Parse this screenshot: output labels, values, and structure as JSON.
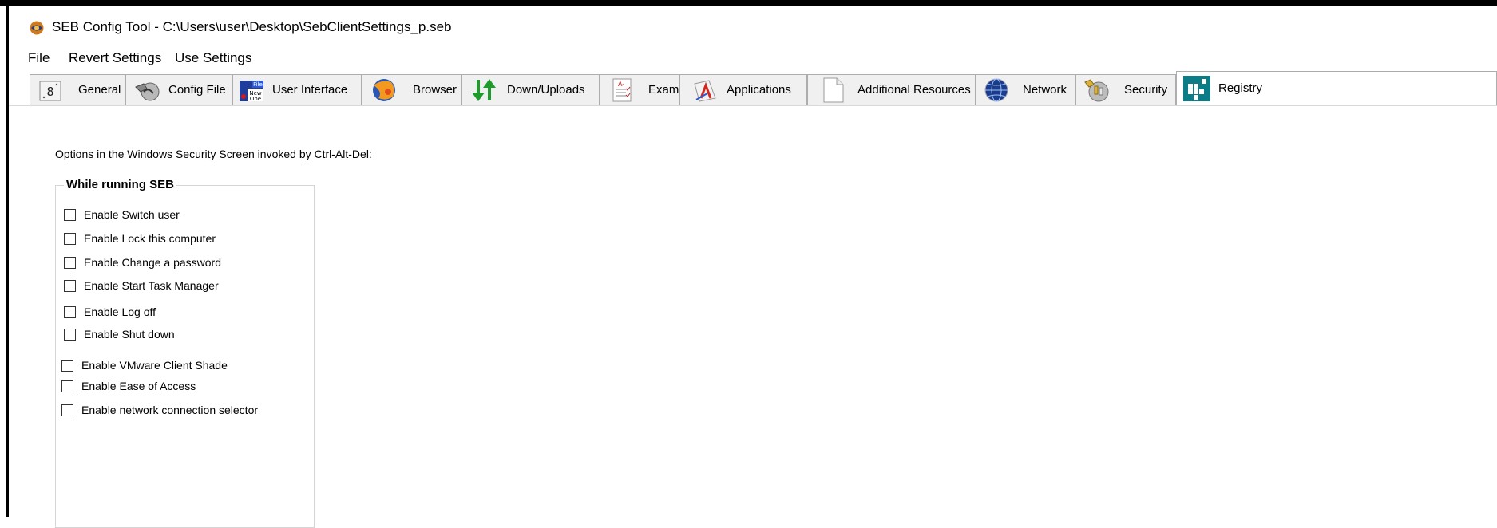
{
  "window": {
    "title": "SEB Config Tool - C:\\Users\\user\\Desktop\\SebClientSettings_p.seb",
    "icon": "seb-app-icon"
  },
  "menu": {
    "file": "File",
    "revert": "Revert Settings",
    "use": "Use Settings"
  },
  "tabs": [
    {
      "label": "General",
      "icon": "general-icon"
    },
    {
      "label": "Config File",
      "icon": "config-file-icon"
    },
    {
      "label": "User Interface",
      "icon": "user-interface-icon"
    },
    {
      "label": "Browser",
      "icon": "browser-icon"
    },
    {
      "label": "Down/Uploads",
      "icon": "down-uploads-icon"
    },
    {
      "label": "Exam",
      "icon": "exam-icon"
    },
    {
      "label": "Applications",
      "icon": "applications-icon"
    },
    {
      "label": "Additional Resources",
      "icon": "document-icon"
    },
    {
      "label": "Network",
      "icon": "network-icon"
    },
    {
      "label": "Security",
      "icon": "security-keys-icon"
    },
    {
      "label": "Registry",
      "icon": "registry-icon",
      "active": true
    }
  ],
  "content": {
    "intro": "Options in the Windows Security Screen invoked by Ctrl-Alt-Del:",
    "group_title": "While running SEB",
    "options": [
      {
        "label": "Enable Switch user",
        "checked": false
      },
      {
        "label": "Enable Lock this computer",
        "checked": false
      },
      {
        "label": "Enable Change a password",
        "checked": false
      },
      {
        "label": "Enable Start Task Manager",
        "checked": false
      },
      {
        "label": "Enable Log off",
        "checked": false
      },
      {
        "label": "Enable Shut down",
        "checked": false
      },
      {
        "label": "Enable VMware Client Shade",
        "checked": false
      },
      {
        "label": "Enable Ease of Access",
        "checked": false
      },
      {
        "label": "Enable network connection selector",
        "checked": false
      }
    ]
  },
  "colors": {
    "accent": "#0078d7",
    "window_bg": "#f0f0f0",
    "tab_border": "#adadad"
  }
}
